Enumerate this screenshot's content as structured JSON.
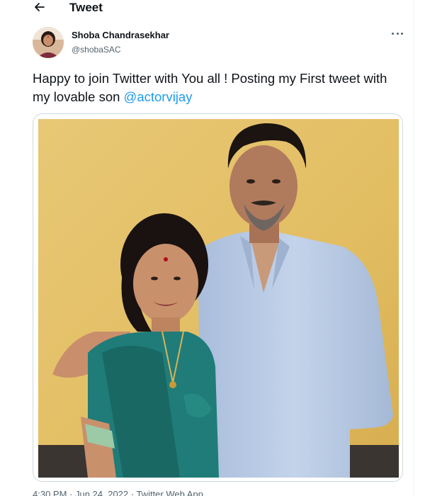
{
  "header": {
    "title": "Tweet",
    "back_icon": "arrow-left-icon"
  },
  "tweet": {
    "author": {
      "name": "Shoba Chandrasekhar",
      "handle": "@shobaSAC"
    },
    "more_icon": "more-horizontal-icon",
    "text_main": "Happy to join Twitter with You all ! Posting my First tweet with my lovable son ",
    "mention": "@actorvijay",
    "timestamp_partial": "4:30 PM · Jun 24, 2022 · Twitter Web App"
  },
  "colors": {
    "link": "#1d9bf0",
    "secondary_text": "#536471",
    "border": "#cfd9de",
    "photo_wall": "#e3c36a",
    "saree": "#1f7c78",
    "shirt": "#b9cbe3"
  }
}
